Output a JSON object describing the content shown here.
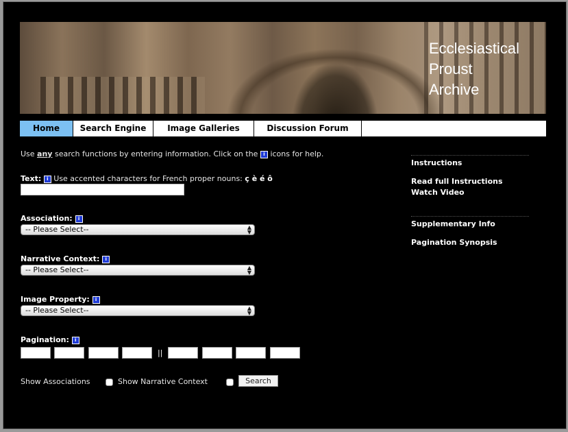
{
  "banner": {
    "title_line1": "Ecclesiastical",
    "title_line2": "Proust",
    "title_line3": "Archive"
  },
  "nav": {
    "tabs": [
      {
        "label": "Home",
        "active": true
      },
      {
        "label": "Search Engine",
        "active": false
      },
      {
        "label": "Image Galleries",
        "active": false
      },
      {
        "label": "Discussion Forum",
        "active": false
      }
    ]
  },
  "intro": {
    "prefix": "Use ",
    "emphasis": "any",
    "middle": " search functions by entering information. Click on the ",
    "suffix": " icons for help."
  },
  "text_field": {
    "label": "Text",
    "hint": " Use accented characters for French proper nouns: ",
    "chars": "ç è é ô",
    "value": ""
  },
  "association": {
    "label": "Association",
    "selected": "-- Please Select--"
  },
  "narrative_context": {
    "label": "Narrative Context",
    "selected": "-- Please Select--"
  },
  "image_property": {
    "label": "Image Property",
    "selected": "-- Please Select--"
  },
  "pagination": {
    "label": "Pagination",
    "separator": "||"
  },
  "options": {
    "show_associations": "Show Associations",
    "show_narrative_context": "Show Narrative Context",
    "search_button": "Search"
  },
  "sidebar": {
    "instructions_heading": "Instructions",
    "read_instructions": "Read full Instructions",
    "watch_video": "Watch Video",
    "supplementary_heading": "Supplementary Info",
    "pagination_synopsis": "Pagination Synopsis"
  },
  "icons": {
    "info_glyph": "i"
  },
  "colors": {
    "active_tab": "#7cc0f2",
    "info_icon": "#1f3bd6",
    "background": "#000000"
  }
}
